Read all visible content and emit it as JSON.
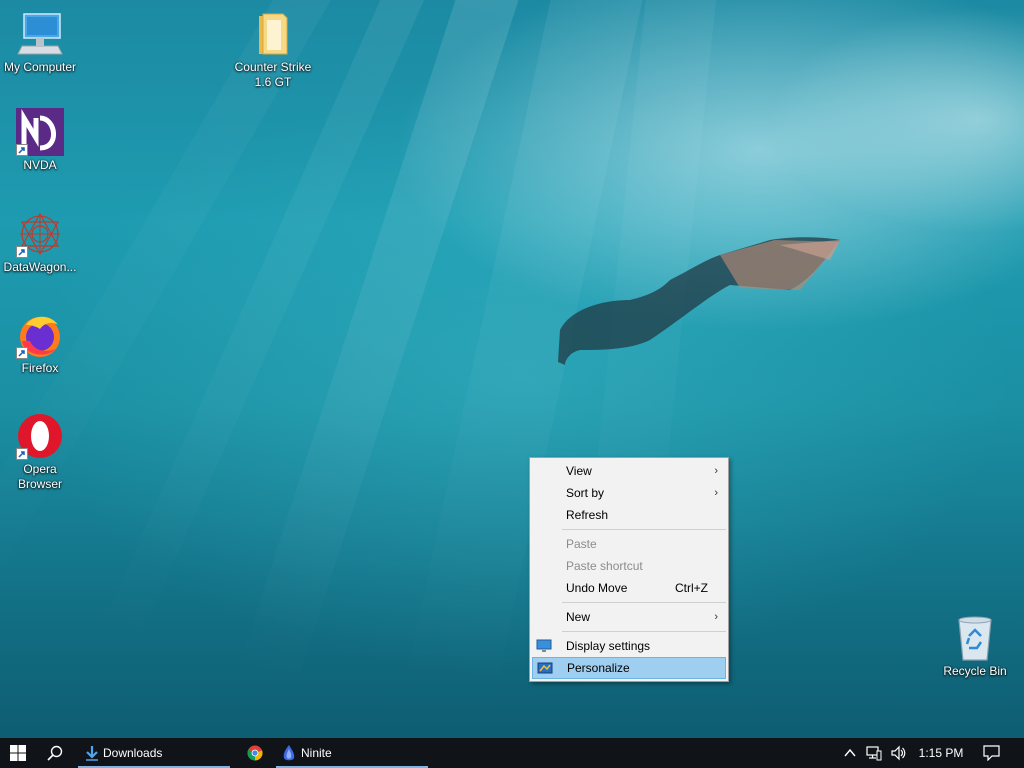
{
  "desktop": {
    "icons": [
      {
        "label": "My Computer",
        "icon": "computer-icon"
      },
      {
        "label": "Counter Strike 1.6 GT",
        "icon": "folder-icon"
      },
      {
        "label": "NVDA",
        "icon": "nvda-icon"
      },
      {
        "label": "DataWagon...",
        "icon": "datawagon-icon"
      },
      {
        "label": "Firefox",
        "icon": "firefox-icon"
      },
      {
        "label": "Opera Browser",
        "icon": "opera-icon"
      },
      {
        "label": "Recycle Bin",
        "icon": "recycle-bin-icon"
      }
    ]
  },
  "context_menu": {
    "items": [
      {
        "label": "View",
        "submenu": true,
        "enabled": true
      },
      {
        "label": "Sort by",
        "submenu": true,
        "enabled": true
      },
      {
        "label": "Refresh",
        "enabled": true
      },
      {
        "label": "Paste",
        "enabled": false
      },
      {
        "label": "Paste shortcut",
        "enabled": false
      },
      {
        "label": "Undo Move",
        "shortcut": "Ctrl+Z",
        "enabled": true
      },
      {
        "label": "New",
        "submenu": true,
        "enabled": true
      },
      {
        "label": "Display settings",
        "icon": "display-settings-icon",
        "enabled": true
      },
      {
        "label": "Personalize",
        "icon": "personalize-icon",
        "enabled": true,
        "highlighted": true
      }
    ],
    "submenu_arrow": "›"
  },
  "taskbar": {
    "apps": [
      {
        "label": "Downloads",
        "icon": "download-arrow-icon",
        "active": true
      },
      {
        "label": "",
        "icon": "chrome-icon",
        "active": false
      },
      {
        "label": "Ninite",
        "icon": "ninite-icon",
        "active": true
      }
    ],
    "tray": {
      "clock": "1:15 PM",
      "chevron": "^"
    }
  },
  "colors": {
    "taskbar_bg": "#101418",
    "menu_bg": "#f2f2f2",
    "menu_highlight": "#9fcff0",
    "menu_highlight_border": "#6fb2e4",
    "active_app_bar": "#7fb4e2"
  }
}
